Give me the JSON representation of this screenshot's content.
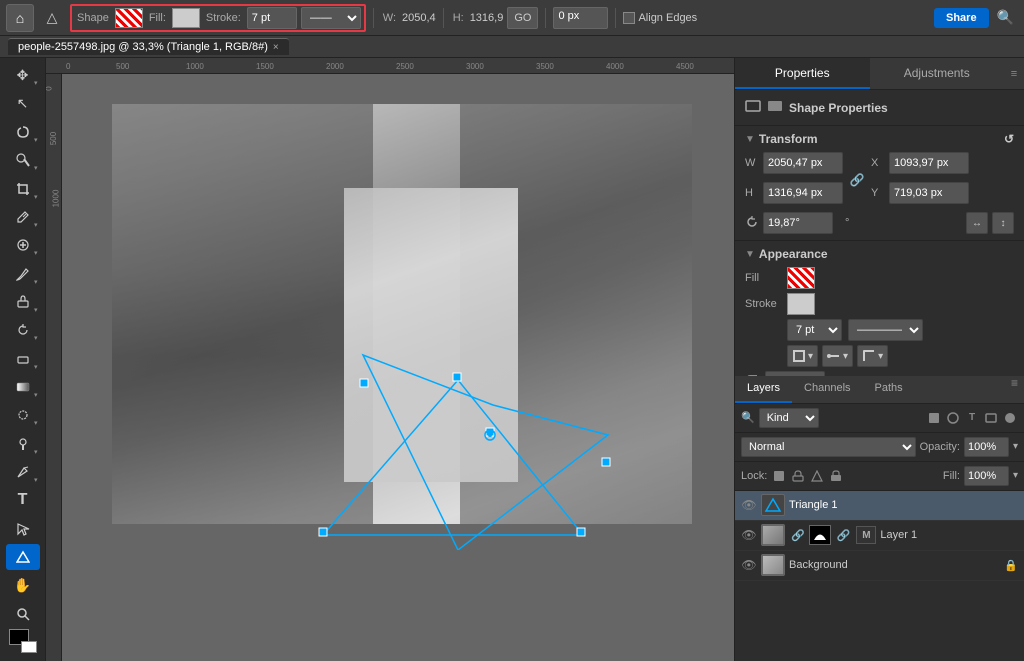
{
  "topbar": {
    "home_icon": "⌂",
    "triangle_icon": "△",
    "shape_label": "Shape",
    "fill_label": "Fill:",
    "stroke_label": "Stroke:",
    "stroke_width": "7 pt",
    "w_label": "W:",
    "w_value": "2050,4",
    "go_label": "GO",
    "h_label": "H:",
    "h_value": "1316,9",
    "corner_radius": "0 px",
    "align_edges": "Align Edges",
    "share_label": "Share"
  },
  "tab": {
    "filename": "people-2557498.jpg @ 33,3% (Triangle 1, RGB/8#)",
    "close": "×",
    "modified": "×"
  },
  "tools": [
    {
      "name": "move-tool",
      "icon": "✥",
      "label": "Move Tool"
    },
    {
      "name": "select-tool",
      "icon": "↖",
      "label": "Select Tool"
    },
    {
      "name": "lasso-tool",
      "icon": "⬠",
      "label": "Lasso Tool"
    },
    {
      "name": "magic-wand-tool",
      "icon": "✧",
      "label": "Magic Wand"
    },
    {
      "name": "crop-tool",
      "icon": "⬚",
      "label": "Crop Tool"
    },
    {
      "name": "eyedropper-tool",
      "icon": "⊘",
      "label": "Eyedropper"
    },
    {
      "name": "healing-tool",
      "icon": "✚",
      "label": "Healing Brush"
    },
    {
      "name": "brush-tool",
      "icon": "✏",
      "label": "Brush Tool"
    },
    {
      "name": "stamp-tool",
      "icon": "⎔",
      "label": "Clone Stamp"
    },
    {
      "name": "history-brush-tool",
      "icon": "↺",
      "label": "History Brush"
    },
    {
      "name": "eraser-tool",
      "icon": "◻",
      "label": "Eraser"
    },
    {
      "name": "gradient-tool",
      "icon": "▦",
      "label": "Gradient Tool"
    },
    {
      "name": "blur-tool",
      "icon": "◉",
      "label": "Blur Tool"
    },
    {
      "name": "dodge-tool",
      "icon": "○",
      "label": "Dodge Tool"
    },
    {
      "name": "pen-tool",
      "icon": "✒",
      "label": "Pen Tool"
    },
    {
      "name": "type-tool",
      "icon": "T",
      "label": "Type Tool"
    },
    {
      "name": "direct-select-tool",
      "icon": "↗",
      "label": "Direct Select"
    },
    {
      "name": "shape-tool",
      "icon": "△",
      "label": "Shape Tool",
      "active": true
    },
    {
      "name": "hand-tool",
      "icon": "✋",
      "label": "Hand Tool"
    },
    {
      "name": "zoom-tool",
      "icon": "🔍",
      "label": "Zoom Tool"
    }
  ],
  "canvas": {
    "ruler_marks": [
      "0",
      "500",
      "1000",
      "1500",
      "2000",
      "2500",
      "3000",
      "3500",
      "4000",
      "4500"
    ],
    "vertical_marks": [
      "0",
      "500",
      "1000"
    ]
  },
  "properties": {
    "tab_properties": "Properties",
    "tab_adjustments": "Adjustments",
    "shape_properties_label": "Shape Properties",
    "transform_label": "Transform",
    "w_label": "W",
    "w_value": "2050,47 px",
    "h_label": "H",
    "h_value": "1316,94 px",
    "x_label": "X",
    "x_value": "1093,97 px",
    "y_label": "Y",
    "y_value": "719,03 px",
    "rotate_value": "19,87°",
    "appearance_label": "Appearance",
    "fill_label": "Fill",
    "stroke_label": "Stroke",
    "stroke_width_value": "7 pt",
    "corner_radius_label": "0 px"
  },
  "layers": {
    "tab_layers": "Layers",
    "tab_channels": "Channels",
    "tab_paths": "Paths",
    "search_placeholder": "Search",
    "filter_label": "Kind",
    "mode_label": "Normal",
    "opacity_label": "Opacity:",
    "opacity_value": "100%",
    "lock_label": "Lock:",
    "fill_label": "Fill:",
    "fill_value": "100%",
    "items": [
      {
        "name": "Triangle 1",
        "type": "triangle",
        "visible": true,
        "active": true
      },
      {
        "name": "Layer 1",
        "type": "masked-photo",
        "visible": true,
        "active": false
      },
      {
        "name": "Background",
        "type": "photo",
        "visible": true,
        "active": false,
        "locked": true
      }
    ]
  }
}
